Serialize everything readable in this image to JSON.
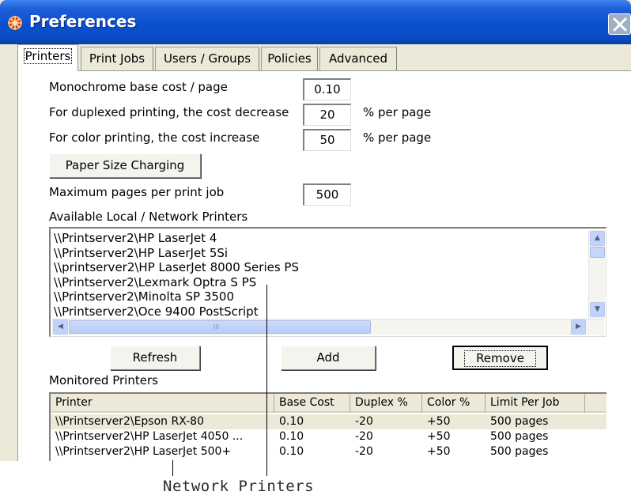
{
  "window": {
    "title": "Preferences",
    "colors": {
      "titlebar": "#0a4fd0",
      "panel": "#ece9d8",
      "selection": "#ece9d8"
    }
  },
  "tabs": [
    {
      "label": "Printers",
      "active": true
    },
    {
      "label": "Print Jobs",
      "active": false
    },
    {
      "label": "Users / Groups",
      "active": false
    },
    {
      "label": "Policies",
      "active": false
    },
    {
      "label": "Advanced",
      "active": false
    }
  ],
  "settings": {
    "mono_cost_label": "Monochrome base cost / page",
    "mono_cost_value": "0.10",
    "duplex_label": "For duplexed printing, the cost decrease",
    "duplex_value": "20",
    "duplex_unit": "% per page",
    "color_label": "For color printing, the cost increase",
    "color_value": "50",
    "color_unit": "% per page",
    "paper_size_button": "Paper Size Charging",
    "max_pages_label": "Maximum pages per print job",
    "max_pages_value": "500"
  },
  "available": {
    "label": "Available Local / Network Printers",
    "items": [
      "\\\\Printserver2\\HP LaserJet 4",
      "\\\\Printserver2\\HP LaserJet 5Si",
      "\\\\printserver2\\HP LaserJet 8000 Series PS",
      "\\\\Printserver2\\Lexmark Optra S PS",
      "\\\\Printserver2\\Minolta SP 3500",
      "\\\\Printserver2\\Oce 9400 PostScript"
    ],
    "scroll_thumb_glyph": "III"
  },
  "buttons": {
    "refresh": "Refresh",
    "add": "Add",
    "remove": "Remove"
  },
  "monitored": {
    "label": "Monitored Printers",
    "columns": [
      "Printer",
      "Base Cost",
      "Duplex %",
      "Color %",
      "Limit Per Job"
    ],
    "rows": [
      [
        "\\\\Printserver2\\Epson RX-80",
        "0.10",
        "-20",
        "+50",
        "500 pages"
      ],
      [
        "\\\\Printserver2\\HP LaserJet 4050 ...",
        "0.10",
        "-20",
        "+50",
        "500 pages"
      ],
      [
        "\\\\Printserver2\\HP LaserJet 500+",
        "0.10",
        "-20",
        "+50",
        "500 pages"
      ]
    ]
  },
  "annotation": "Network Printers"
}
